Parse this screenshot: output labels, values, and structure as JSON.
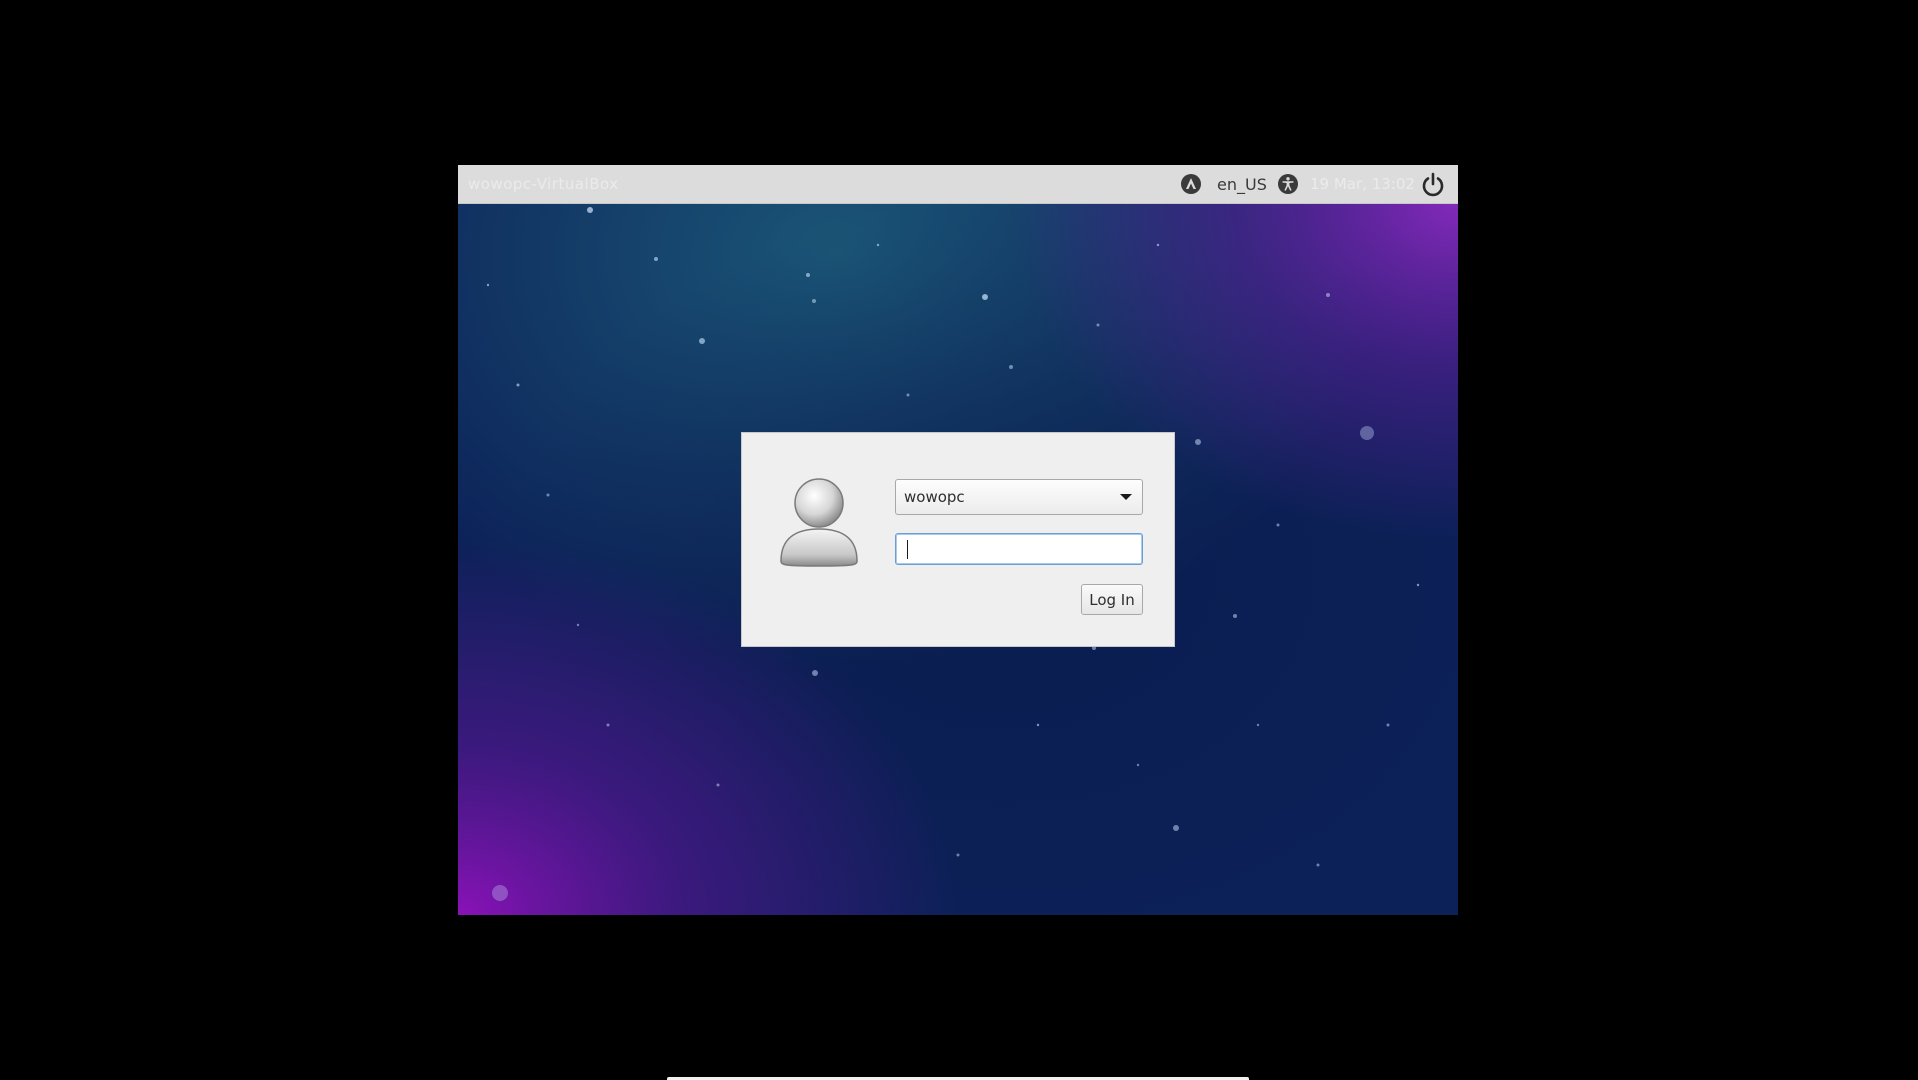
{
  "top_bar": {
    "hostname": "wowopc-VirtualBox",
    "language": "en_US",
    "clock": "19 Mar, 13:02",
    "icons": {
      "session": "session-icon",
      "accessibility": "accessibility-icon",
      "power": "power-icon"
    }
  },
  "login": {
    "avatar_icon": "user-avatar-icon",
    "selected_user": "wowopc",
    "password_value": "",
    "login_button_label": "Log In"
  },
  "colors": {
    "top_bar_background": "#dcdcdc",
    "dialog_background": "#efefef",
    "input_focus_border": "#6a9fd6",
    "wallpaper_base": "#0c1f52",
    "wallpaper_accent": "#7a1fb0"
  }
}
